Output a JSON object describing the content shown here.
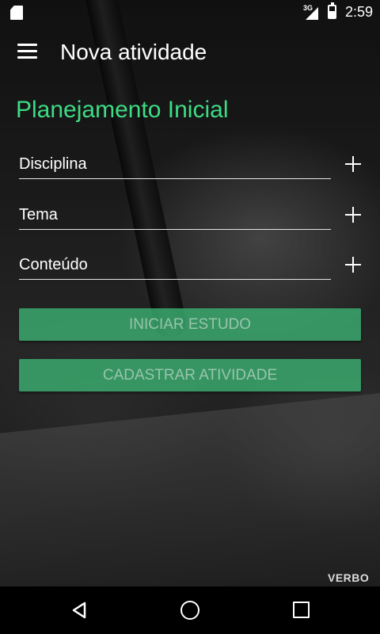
{
  "status_bar": {
    "network_label": "3G",
    "time": "2:59",
    "icons": [
      "sd-card-icon",
      "signal-icon",
      "battery-charging-icon"
    ]
  },
  "app_bar": {
    "title": "Nova atividade",
    "menu_icon": "hamburger-menu-icon"
  },
  "main": {
    "section_title": "Planejamento Inicial",
    "fields": [
      {
        "label": "Disciplina",
        "action_icon": "plus-icon"
      },
      {
        "label": "Tema",
        "action_icon": "plus-icon"
      },
      {
        "label": "Conteúdo",
        "action_icon": "plus-icon"
      }
    ],
    "buttons": {
      "start_study": "INICIAR ESTUDO",
      "register_activity": "CADASTRAR ATIVIDADE"
    }
  },
  "watermark": "VERBO",
  "nav_bar": {
    "icons": [
      "back-icon",
      "home-icon",
      "recent-apps-icon"
    ]
  },
  "colors": {
    "accent": "#3ddc84",
    "button": "#3bb573",
    "navbar": "#000000"
  }
}
